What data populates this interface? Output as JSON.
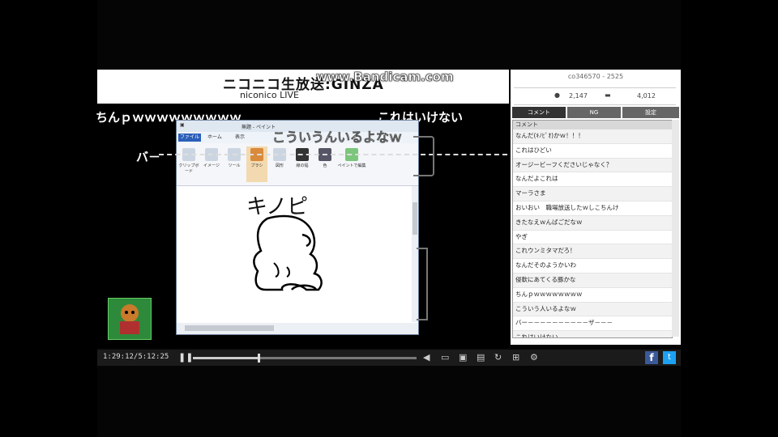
{
  "header": {
    "logo_main": "ニコニコ生放送:GINZA",
    "logo_sub": "niconico LIVE"
  },
  "watermark": "www.Bandicam.com",
  "overlay": {
    "comment_left": "ちんｐｗｗｗｗｗｗｗｗｗ",
    "comment_right": "これはいけない",
    "comment_mid": "こういうんいるよなｗ",
    "comment_bar": "バ－"
  },
  "paint": {
    "title": "無題 - ペイント",
    "tab_file": "ファイル",
    "tab_home": "ホーム",
    "tab_view": "表示",
    "ribbon": [
      "クリップボード",
      "イメージ",
      "ツール",
      "ブラシ",
      "図形",
      "線の幅",
      "色",
      "ペイントで編集"
    ],
    "drawing_text": "キノピ"
  },
  "player": {
    "time": "1:29:12/5:12:25",
    "progress_fraction": 0.29
  },
  "panel": {
    "title": "co346570 - 2525",
    "viewers": "2,147",
    "comments": "4,012",
    "tabs": [
      "コメント",
      "NG",
      "設定"
    ],
    "list_header": "コメント",
    "comments_list": [
      "なんだ(ｷﾉﾋﾟｵ)かｗ！！！",
      "これはひどい",
      "オージービーフくださいじゃなく？",
      "なんだよこれは",
      "マーラさま",
      "おいおい　職場放送したｗしこちんけ",
      "きたなえｗんばごだなｗ",
      "やぎ",
      "これウンミタマだろ！",
      "なんだそのようかいわ",
      "侵軟にあてくる豚かな",
      "ちんｐｗｗｗｗｗｗｗｗ",
      "こういう人いるよなｗ",
      "バー－－－－－－－－－－ザ－－－",
      "これはいけない"
    ]
  },
  "colors": {
    "facebook": "#3b5998",
    "twitter": "#1da1f2",
    "tab_active": "#2b5fb8"
  }
}
